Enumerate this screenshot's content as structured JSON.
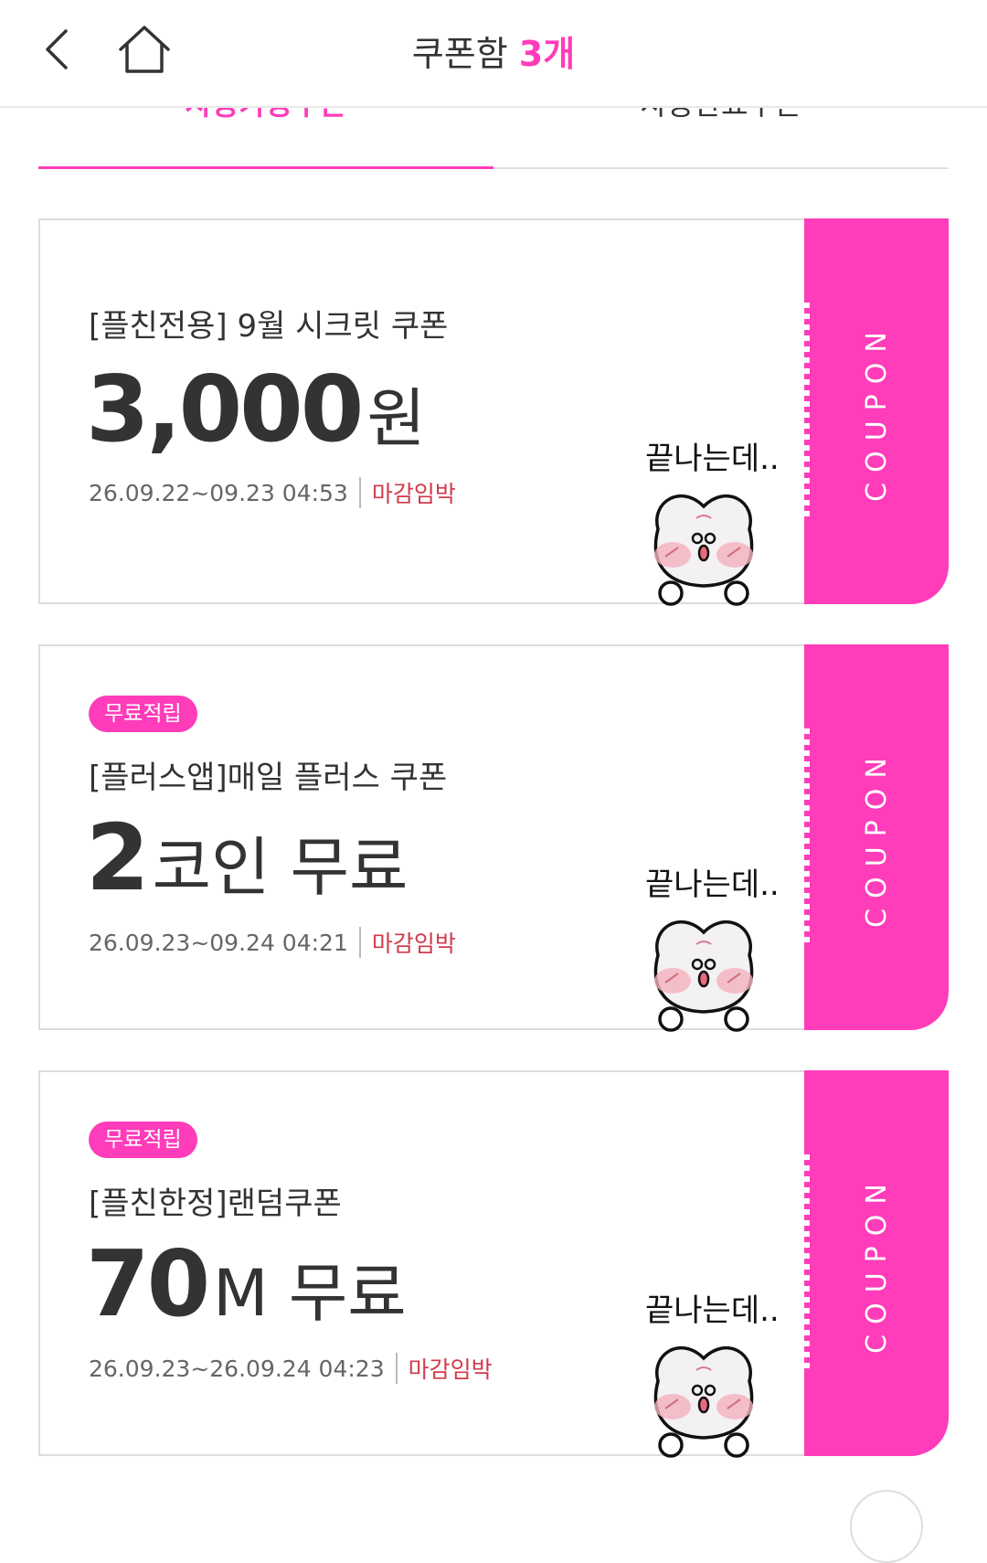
{
  "header": {
    "title": "쿠폰함",
    "count": "3개"
  },
  "tabs": {
    "active": "사용가능쿠폰",
    "inactive": "사용완료쿠폰"
  },
  "colors": {
    "accent": "#ff3cb9",
    "deadline": "#d13b4a"
  },
  "coupons": [
    {
      "badge": "",
      "name": "[플친전용] 9월 시크릿 쿠폰",
      "amount": "3,000",
      "unit": "원",
      "period": "26.09.22~09.23 04:53",
      "deadline": "마감임박",
      "stub": "COUPON",
      "sticker_text": "끝나는데.."
    },
    {
      "badge": "무료적립",
      "name": "[플러스앱]매일 플러스 쿠폰",
      "amount": "2",
      "unit": "코인 무료",
      "period": "26.09.23~09.24 04:21",
      "deadline": "마감임박",
      "stub": "COUPON",
      "sticker_text": "끝나는데.."
    },
    {
      "badge": "무료적립",
      "name": "[플친한정]랜덤쿠폰",
      "amount": "70",
      "unit": "M 무료",
      "period": "26.09.23~26.09.24 04:23",
      "deadline": "마감임박",
      "stub": "COUPON",
      "sticker_text": "끝나는데.."
    }
  ]
}
